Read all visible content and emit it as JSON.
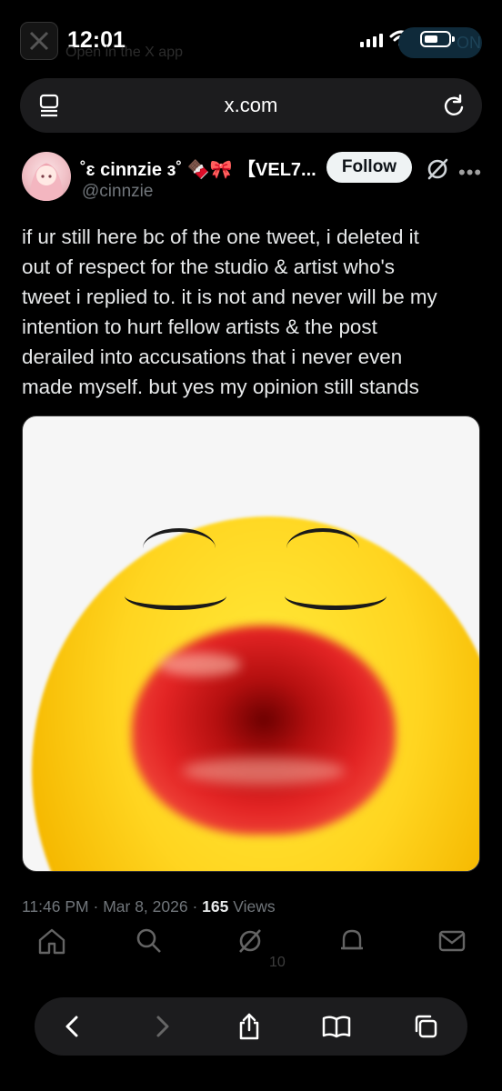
{
  "status_bar": {
    "time": "12:01",
    "open_in_app": "Open in the X app",
    "pill_text": "ON"
  },
  "browser": {
    "url": "x.com",
    "toolbar_icons": [
      "back-icon",
      "forward-icon",
      "share-icon",
      "bookmarks-icon",
      "tabs-icon"
    ]
  },
  "tweet": {
    "display_name": "˚ɛ cinnzie ɜ˚ 🍫🎀 【VEL7...",
    "handle": "@cinnzie",
    "follow_label": "Follow",
    "lines": [
      "if ur still here bc of the one tweet, i deleted it",
      "out of respect for the studio & artist who's",
      "tweet i replied to. it is not and never will be my",
      "intention to hurt fellow artists & the post",
      "derailed into accusations that i never even",
      "made myself. but yes my opinion still stands"
    ],
    "time": "11:46 PM",
    "date": "Mar 8, 2026",
    "views_count": "165",
    "views_label": "Views",
    "like_count": "10"
  },
  "colors": {
    "background": "#000000",
    "text": "#e7e9ea",
    "muted": "#71767b",
    "toolbar": "#1c1c1e"
  }
}
